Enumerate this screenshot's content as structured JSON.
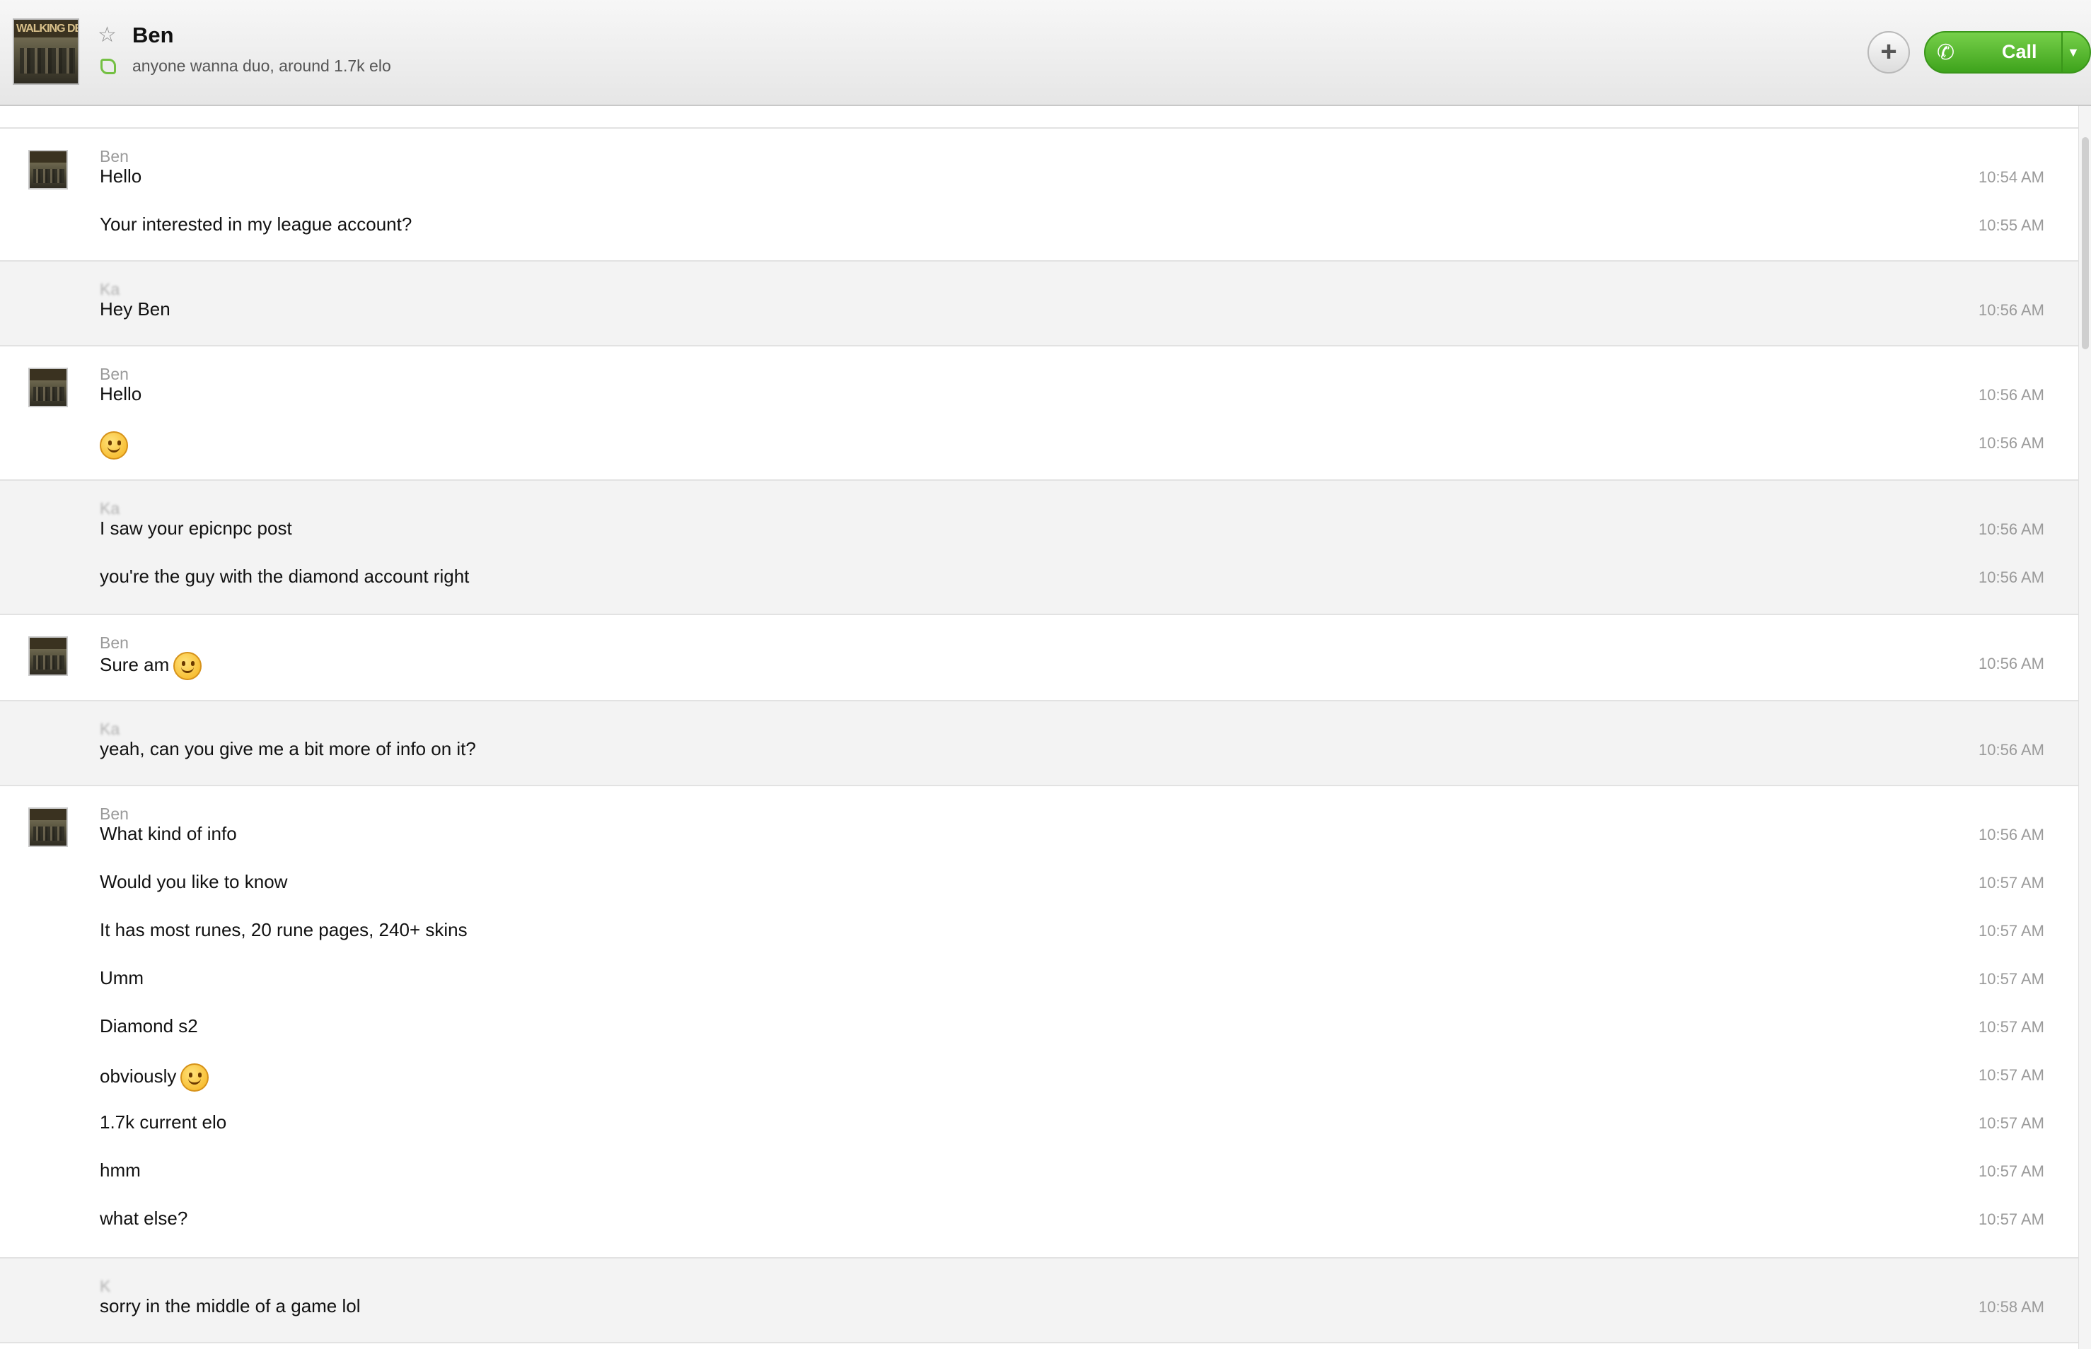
{
  "header": {
    "contact_name": "Ben",
    "mood_message": "anyone wanna duo, around 1.7k elo",
    "avatar_text": "WALKING DEA",
    "add_label": "+",
    "call_label": "Call"
  },
  "chat": {
    "blocks": [
      {
        "sender": "Ben",
        "messages": [
          {
            "text": "Hello",
            "time": "10:54 AM"
          },
          {
            "text": "Your interested in my league account?",
            "time": "10:55 AM"
          }
        ]
      },
      {
        "sender": "Ka",
        "messages": [
          {
            "text": "Hey Ben",
            "time": "10:56 AM"
          }
        ]
      },
      {
        "sender": "Ben",
        "messages": [
          {
            "text": "Hello",
            "time": "10:56 AM"
          },
          {
            "text": "",
            "time": "10:56 AM",
            "emoji": "smiley"
          }
        ]
      },
      {
        "sender": "Ka",
        "messages": [
          {
            "text": "I saw your epicnpc post",
            "time": "10:56 AM"
          },
          {
            "text": "you're the guy with the diamond account right",
            "time": "10:56 AM"
          }
        ]
      },
      {
        "sender": "Ben",
        "messages": [
          {
            "text": "Sure am",
            "time": "10:56 AM",
            "emoji": "smiley"
          }
        ]
      },
      {
        "sender": "Ka",
        "messages": [
          {
            "text": "yeah, can you give me a bit more of info on it?",
            "time": "10:56 AM"
          }
        ]
      },
      {
        "sender": "Ben",
        "messages": [
          {
            "text": "What kind of info",
            "time": "10:56 AM"
          },
          {
            "text": "Would you like to know",
            "time": "10:57 AM"
          },
          {
            "text": "It has most runes, 20 rune pages, 240+ skins",
            "time": "10:57 AM"
          },
          {
            "text": "Umm",
            "time": "10:57 AM"
          },
          {
            "text": "Diamond s2",
            "time": "10:57 AM"
          },
          {
            "text": "obviously",
            "time": "10:57 AM",
            "emoji": "smiley"
          },
          {
            "text": "1.7k current elo",
            "time": "10:57 AM"
          },
          {
            "text": "hmm",
            "time": "10:57 AM"
          },
          {
            "text": "what else?",
            "time": "10:57 AM"
          }
        ]
      },
      {
        "sender": "K",
        "messages": [
          {
            "text": "sorry in the middle of a game lol",
            "time": "10:58 AM"
          }
        ]
      }
    ]
  }
}
